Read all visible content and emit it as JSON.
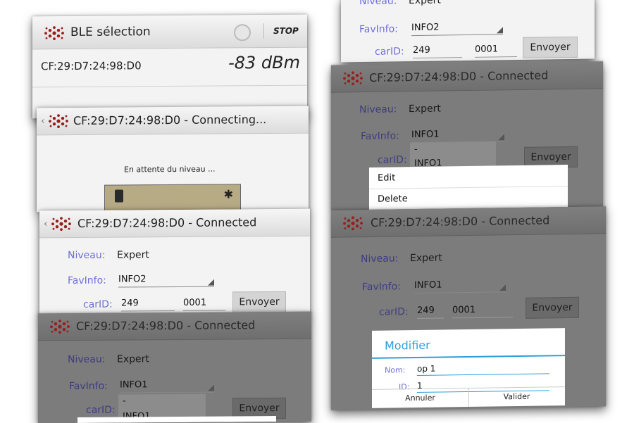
{
  "cards": {
    "ble": {
      "title": "BLE sélection",
      "stop": "STOP",
      "address": "CF:29:D7:24:98:D0",
      "rssi": "-83 dBm"
    },
    "connecting": {
      "title": "CF:29:D7:24:98:D0 - Connecting...",
      "message": "En attente du niveau ..."
    },
    "c3": {
      "title": "CF:29:D7:24:98:D0 - Connected",
      "niveau_label": "Niveau:",
      "niveau_value": "Expert",
      "fav_label": "FavInfo:",
      "fav_value": "INFO2",
      "carid_label": "carID:",
      "carid_value": "249",
      "code_value": "0001",
      "send": "Envoyer"
    },
    "c4": {
      "title": "CF:29:D7:24:98:D0 - Connected",
      "niveau_label": "Niveau:",
      "niveau_value": "Expert",
      "fav_label": "FavInfo:",
      "fav_value": "INFO1",
      "carid_label": "carID:",
      "send": "Envoyer",
      "dropdown_item": "-",
      "dropdown_item2": "INFO1"
    },
    "r1": {
      "niveau_label": "Niveau:",
      "niveau_value": "Expert",
      "fav_label": "FavInfo:",
      "fav_value": "INFO2",
      "carid_label": "carID:",
      "carid_value": "249",
      "code_value": "0001",
      "send": "Envoyer"
    },
    "r2": {
      "title": "CF:29:D7:24:98:D0 - Connected",
      "niveau_label": "Niveau:",
      "niveau_value": "Expert",
      "fav_label": "FavInfo:",
      "fav_value": "INFO1",
      "carid_label": "carID:",
      "send": "Envoyer",
      "dropdown_item": "-",
      "dropdown_item2": "INFO1",
      "menu_edit": "Edit",
      "menu_delete": "Delete"
    },
    "r3": {
      "title": "CF:29:D7:24:98:D0 - Connected",
      "niveau_label": "Niveau:",
      "niveau_value": "Expert",
      "fav_label": "FavInfo:",
      "fav_value": "INFO1",
      "carid_label": "carID:",
      "carid_value": "249",
      "code_value": "0001",
      "send": "Envoyer",
      "dialog": {
        "title": "Modifier",
        "name_label": "Nom:",
        "name_value": "op 1",
        "id_label": "ID:",
        "id_value": "1",
        "cancel": "Annuler",
        "ok": "Valider"
      }
    }
  },
  "colors": {
    "label": "#6f6fd8",
    "accent": "#2aa0d8",
    "logo": "#9b1c1c"
  }
}
